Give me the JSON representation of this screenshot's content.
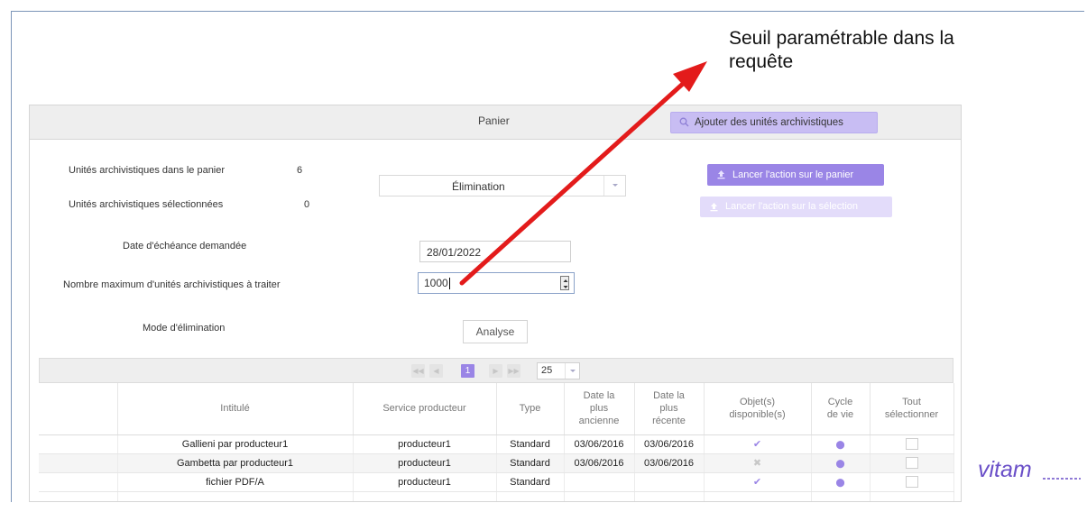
{
  "annotation": {
    "line1": "Seuil paramétrable dans la",
    "line2": "requête",
    "color": "#e31b1b"
  },
  "panel": {
    "title": "Panier",
    "add_button": "Ajouter des unités archivistiques"
  },
  "stats": {
    "in_basket_label": "Unités archivistiques dans le panier",
    "in_basket_value": "6",
    "selected_label": "Unités archivistiques sélectionnées",
    "selected_value": "0"
  },
  "action": {
    "selected": "Élimination",
    "run_basket": "Lancer l'action sur le panier",
    "run_selection": "Lancer l'action sur la sélection"
  },
  "form": {
    "date_label": "Date d'échéance demandée",
    "date_value": "28/01/2022",
    "max_label": "Nombre maximum d'unités archivistiques à traiter",
    "max_value": "1000",
    "mode_label": "Mode d'élimination",
    "mode_button": "Analyse"
  },
  "pager": {
    "current_page": "1",
    "page_size": "25"
  },
  "table": {
    "headers": {
      "title": "Intitulé",
      "producer": "Service producteur",
      "type": "Type",
      "oldest_1": "Date la",
      "oldest_2": "plus",
      "oldest_3": "ancienne",
      "newest_1": "Date la",
      "newest_2": "plus",
      "newest_3": "récente",
      "objects_1": "Objet(s)",
      "objects_2": "disponible(s)",
      "cycle_1": "Cycle",
      "cycle_2": "de vie",
      "select_1": "Tout",
      "select_2": "sélectionner"
    },
    "rows": [
      {
        "title": "Gallieni par producteur1",
        "producer": "producteur1",
        "type": "Standard",
        "oldest": "03/06/2016",
        "newest": "03/06/2016",
        "objects": "available"
      },
      {
        "title": "Gambetta par producteur1",
        "producer": "producteur1",
        "type": "Standard",
        "oldest": "03/06/2016",
        "newest": "03/06/2016",
        "objects": "unavailable"
      },
      {
        "title": "fichier PDF/A",
        "producer": "producteur1",
        "type": "Standard",
        "oldest": "",
        "newest": "",
        "objects": "available"
      }
    ]
  },
  "logo": {
    "text": "vitam"
  },
  "colors": {
    "accent": "#9a85e6",
    "accent_light": "#c8bdf3",
    "logo_purple": "#6a4fc8"
  },
  "icons": {
    "search": "search-icon",
    "upload": "upload-icon",
    "check": "check-icon",
    "cross": "cross-icon",
    "cycle": "lifecycle-icon"
  }
}
